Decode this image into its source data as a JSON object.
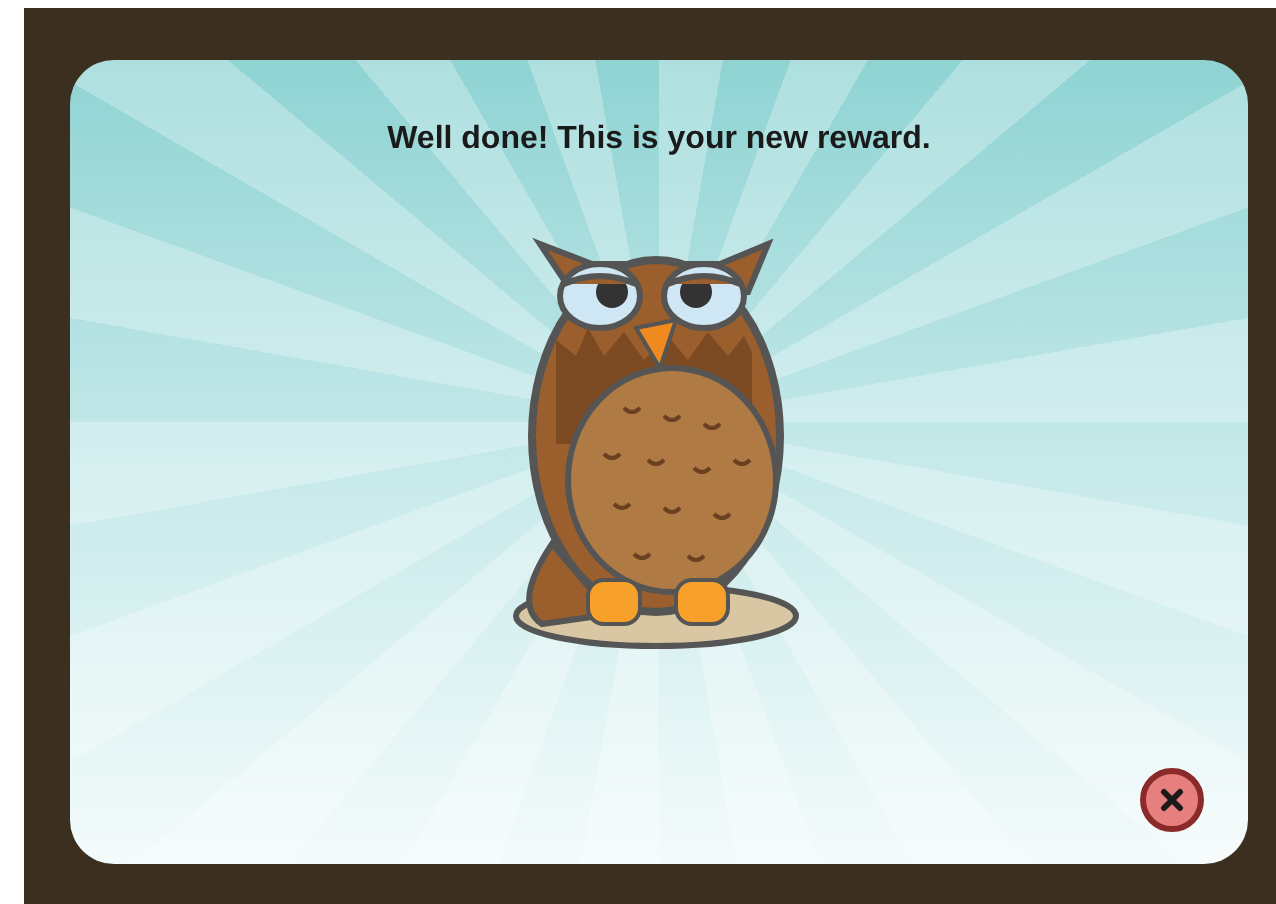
{
  "dialog": {
    "message": "Well done! This is your new reward."
  }
}
